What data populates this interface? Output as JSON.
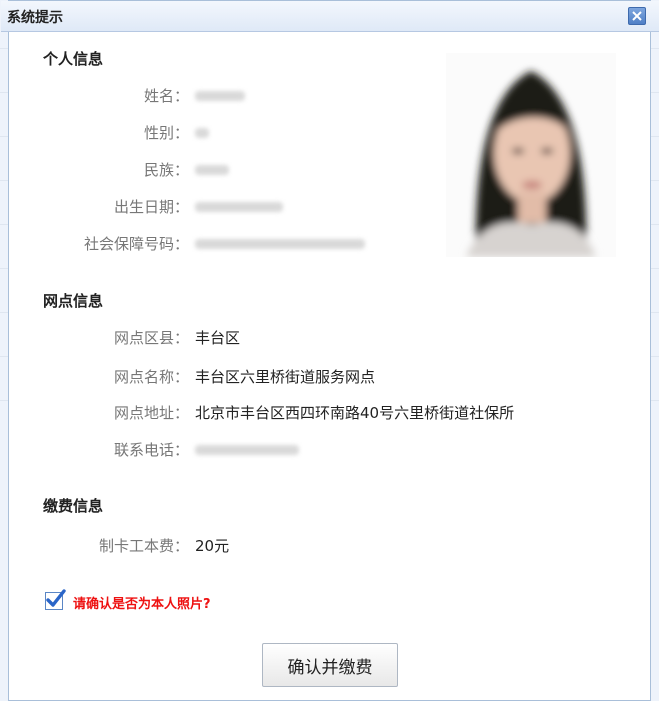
{
  "dialog": {
    "title": "系统提示",
    "close_icon": "close-icon"
  },
  "personal": {
    "title": "个人信息",
    "fields": [
      {
        "label": "姓名："
      },
      {
        "label": "性别："
      },
      {
        "label": "民族："
      },
      {
        "label": "出生日期："
      },
      {
        "label": "社会保障号码："
      }
    ]
  },
  "branch": {
    "title": "网点信息",
    "fields": [
      {
        "label": "网点区县：",
        "value": "丰台区"
      },
      {
        "label": "网点名称：",
        "value": "丰台区六里桥街道服务网点"
      },
      {
        "label": "网点地址：",
        "value": "北京市丰台区西四环南路40号六里桥街道社保所"
      },
      {
        "label": "联系电话："
      }
    ]
  },
  "payment": {
    "title": "缴费信息",
    "fields": [
      {
        "label": "制卡工本费：",
        "value": "20元"
      }
    ]
  },
  "confirm": {
    "text": "请确认是否为本人照片?",
    "checked": true
  },
  "button": {
    "label": "确认并缴费"
  },
  "colors": {
    "accent": "#4f7fc6",
    "warning": "#e11111"
  }
}
